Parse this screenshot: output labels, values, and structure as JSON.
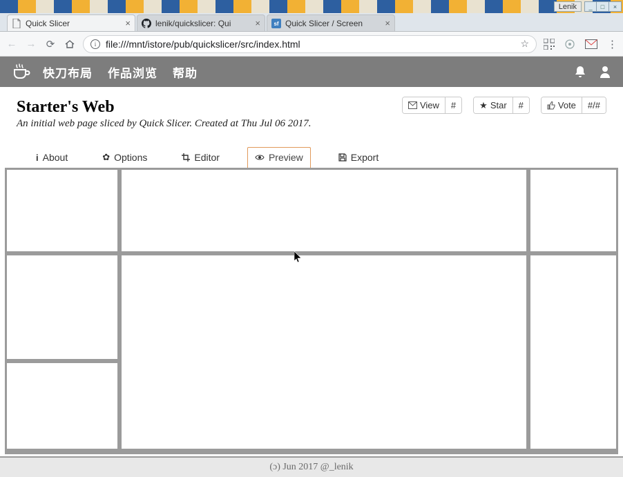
{
  "window": {
    "title": "Lenik",
    "min_label": "_",
    "max_label": "□",
    "close_label": "×"
  },
  "browser": {
    "tabs": [
      {
        "label": "Quick Slicer",
        "icon": "page",
        "active": true
      },
      {
        "label": "lenik/quickslicer: Qui",
        "icon": "github",
        "active": false
      },
      {
        "label": "Quick Slicer / Screen",
        "icon": "sf",
        "active": false
      }
    ],
    "url": "file:///mnt/istore/pub/quickslicer/src/index.html"
  },
  "app": {
    "nav": [
      {
        "label": "快刀布局"
      },
      {
        "label": "作品浏览"
      },
      {
        "label": "帮助"
      }
    ]
  },
  "page": {
    "title": "Starter's Web",
    "subtitle": "An initial web page sliced by Quick Slicer. Created at Thu Jul 06 2017."
  },
  "actions": {
    "view": {
      "label": "View",
      "count": "#"
    },
    "star": {
      "label": "Star",
      "count": "#"
    },
    "vote": {
      "label": "Vote",
      "count": "#/#"
    }
  },
  "subtabs": {
    "about": "About",
    "options": "Options",
    "editor": "Editor",
    "preview": "Preview",
    "export": "Export"
  },
  "footer": {
    "text": "(ɔ) Jun 2017 @_lenik"
  }
}
